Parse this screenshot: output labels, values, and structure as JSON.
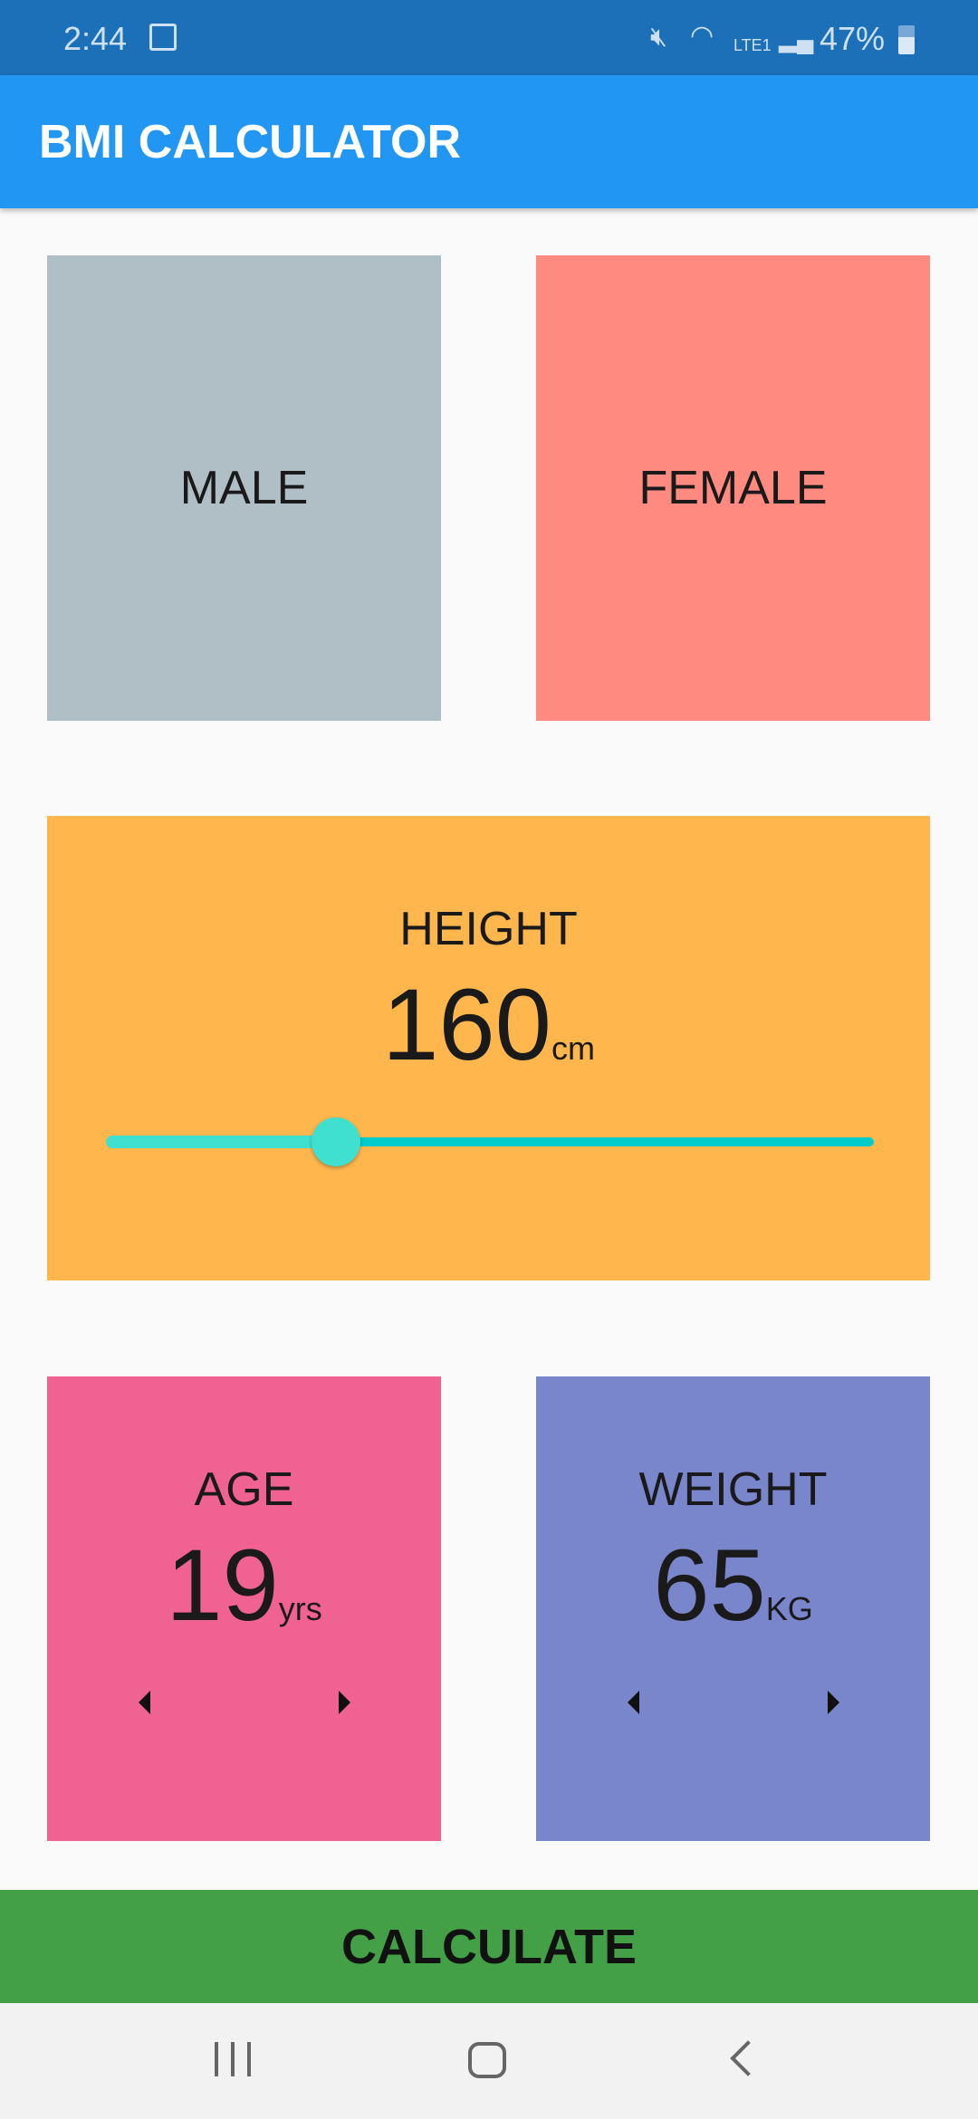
{
  "status_bar": {
    "time": "2:44",
    "battery": "47%",
    "network": "LTE1"
  },
  "app_bar": {
    "title": "BMI CALCULATOR",
    "color": "#2196f3"
  },
  "gender": {
    "male_label": "MALE",
    "female_label": "FEMALE",
    "male_color": "#b0bec5",
    "female_color": "#ff8a80"
  },
  "height": {
    "label": "HEIGHT",
    "value": "160",
    "unit": "cm",
    "slider_fraction": 0.3,
    "color": "#ffb74d"
  },
  "age": {
    "label": "AGE",
    "value": "19",
    "unit": "yrs",
    "color": "#f06292"
  },
  "weight": {
    "label": "WEIGHT",
    "value": "65",
    "unit": "KG",
    "color": "#7986cb"
  },
  "calculate_label": "CALCULATE"
}
